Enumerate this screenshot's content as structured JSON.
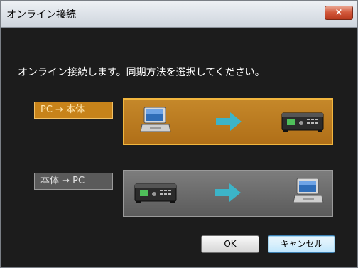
{
  "window": {
    "title": "オンライン接続",
    "close_label": "×"
  },
  "message": "オンライン接続します。同期方法を選択してください。",
  "options": [
    {
      "label": "PC → 本体",
      "selected": true,
      "from": "laptop-icon",
      "to": "device-icon"
    },
    {
      "label": "本体 → PC",
      "selected": false,
      "from": "device-icon",
      "to": "laptop-icon"
    }
  ],
  "buttons": {
    "ok_label": "OK",
    "cancel_label": "キャンセル"
  },
  "colors": {
    "accent_orange": "#c7831a",
    "accent_border": "#f2b63e",
    "arrow_cyan": "#3cb4c8",
    "background": "#1c1c1c"
  }
}
